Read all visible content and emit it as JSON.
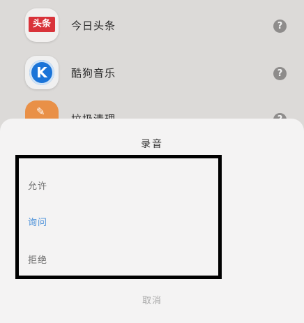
{
  "apps": [
    {
      "name": "今日头条",
      "icon_text": "头条",
      "icon": "toutiao-icon"
    },
    {
      "name": "酷狗音乐",
      "icon_text": "K",
      "icon": "kugou-icon"
    },
    {
      "name": "垃圾清理",
      "icon": "broom-icon"
    }
  ],
  "help_glyph": "?",
  "sheet": {
    "title": "录音",
    "options": [
      {
        "label": "允许"
      },
      {
        "label": "询问",
        "selected": true
      },
      {
        "label": "拒绝"
      }
    ],
    "cancel_label": "取消"
  },
  "colors": {
    "selected": "#4a90d9",
    "highlight_border": "#000000",
    "toutiao_red": "#d9333a",
    "kugou_blue": "#1a74d8",
    "clean_orange": "#e99047"
  }
}
